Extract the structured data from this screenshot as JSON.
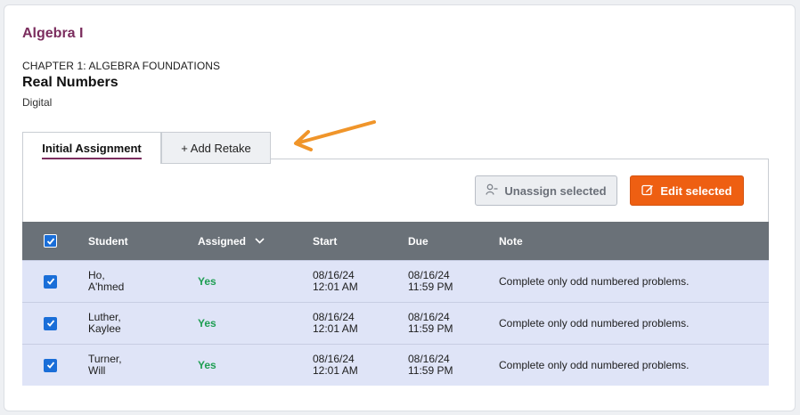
{
  "course": {
    "title": "Algebra I"
  },
  "lesson": {
    "chapter": "CHAPTER 1: ALGEBRA FOUNDATIONS",
    "title": "Real Numbers",
    "mode": "Digital"
  },
  "tabs": {
    "initial": "Initial Assignment",
    "retake": "+ Add Retake"
  },
  "actions": {
    "unassign_label": "Unassign selected",
    "edit_label": "Edit selected"
  },
  "table": {
    "headers": {
      "student": "Student",
      "assigned": "Assigned",
      "start": "Start",
      "due": "Due",
      "note": "Note"
    },
    "rows": [
      {
        "last": "Ho,",
        "first": "A'hmed",
        "assigned": "Yes",
        "start_date": "08/16/24",
        "start_time": "12:01 AM",
        "due_date": "08/16/24",
        "due_time": "11:59 PM",
        "note": "Complete only odd numbered problems.",
        "checked": true
      },
      {
        "last": "Luther,",
        "first": "Kaylee",
        "assigned": "Yes",
        "start_date": "08/16/24",
        "start_time": "12:01 AM",
        "due_date": "08/16/24",
        "due_time": "11:59 PM",
        "note": "Complete only odd numbered problems.",
        "checked": true
      },
      {
        "last": "Turner,",
        "first": "Will",
        "assigned": "Yes",
        "start_date": "08/16/24",
        "start_time": "12:01 AM",
        "due_date": "08/16/24",
        "due_time": "11:59 PM",
        "note": "Complete only odd numbered problems.",
        "checked": true
      }
    ]
  },
  "colors": {
    "course_title": "#7b2d5e",
    "primary_action": "#ee5f12",
    "header_bg": "#6a7178",
    "row_bg": "#dfe4f7",
    "assigned_yes": "#1e9e52",
    "arrow": "#f0952a",
    "checkbox": "#1a6ed8"
  },
  "icons": {
    "unassign": "person-minus-icon",
    "edit": "edit-icon",
    "sort": "chevron-down-icon",
    "annotation": "arrow-icon"
  }
}
